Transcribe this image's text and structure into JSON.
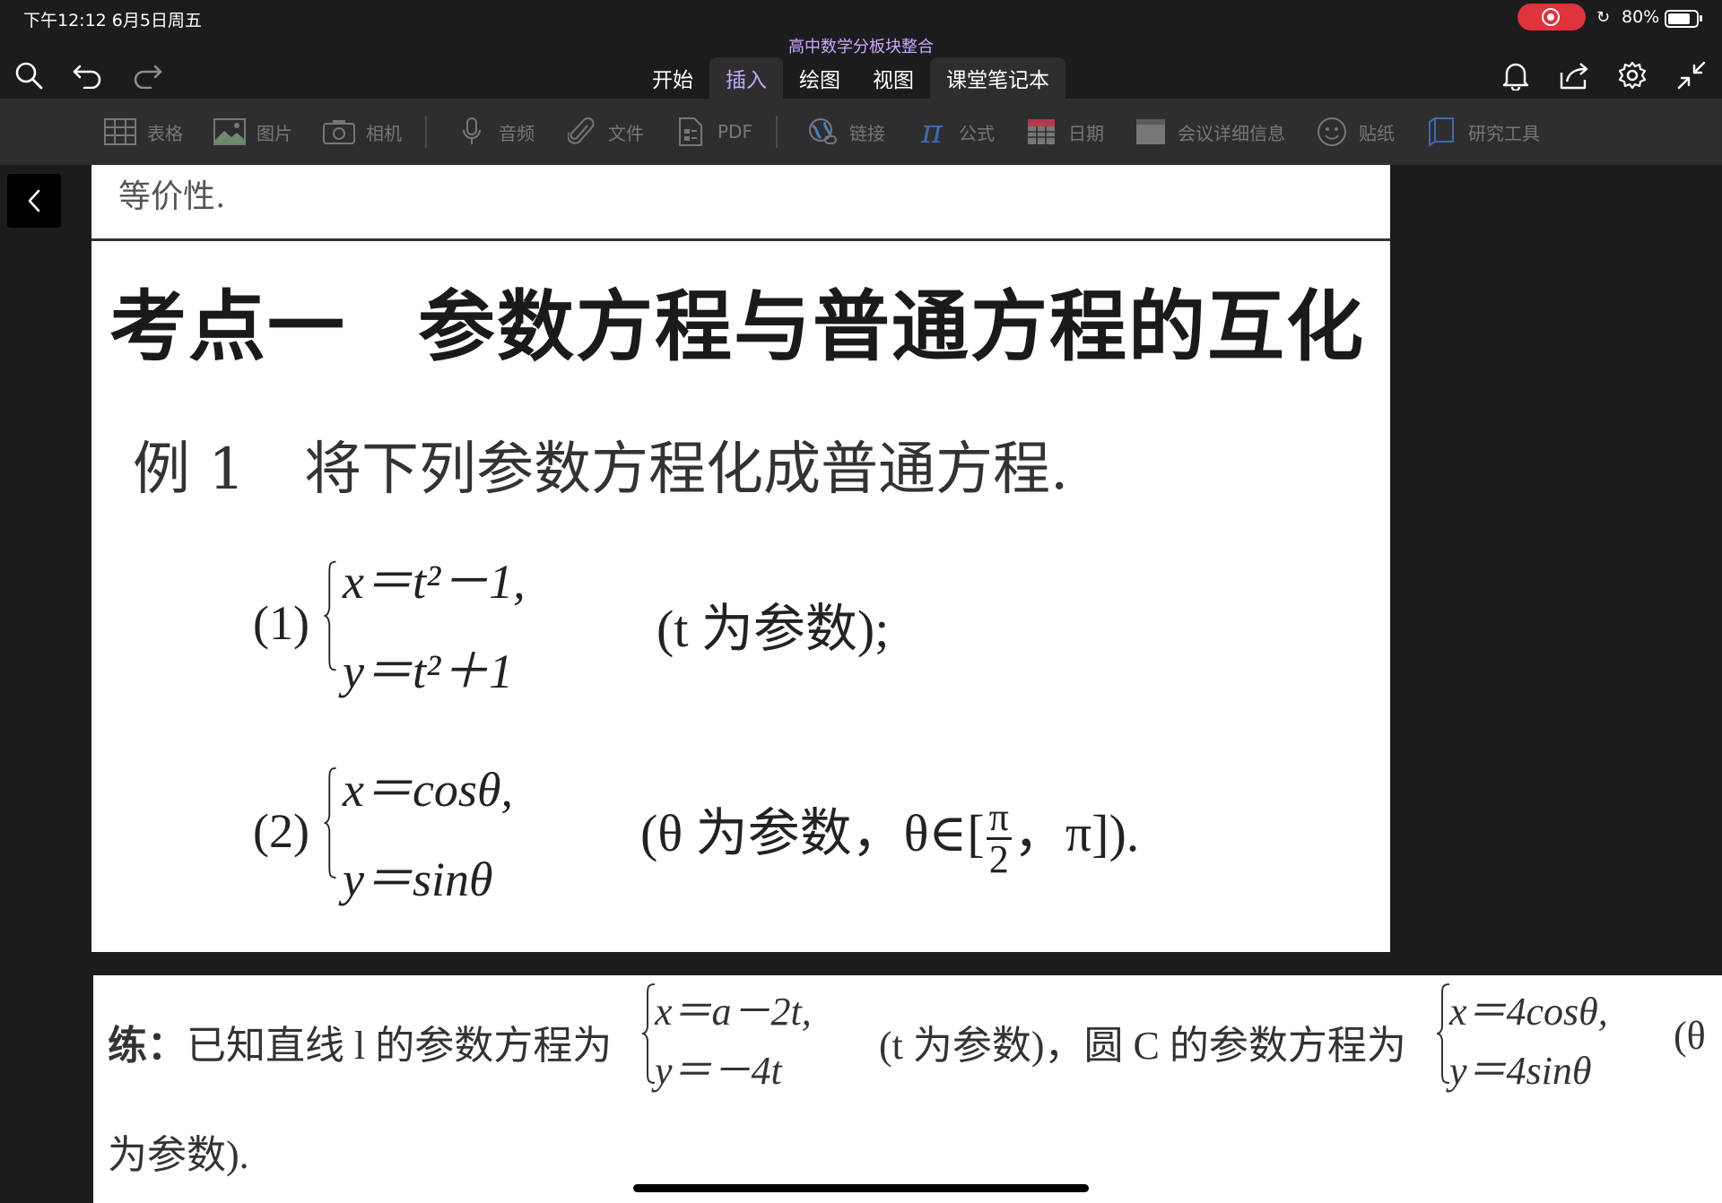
{
  "status_bar": {
    "time": "下午12:12   6月5日周五",
    "battery_percent": "80%",
    "battery_level": 0.8
  },
  "header": {
    "document_title": "高中数学分板块整合",
    "tabs": [
      "开始",
      "插入",
      "绘图",
      "视图",
      "课堂笔记本"
    ],
    "active_tab": "插入"
  },
  "ribbon": {
    "items": [
      "表格",
      "图片",
      "相机",
      "音频",
      "文件",
      "PDF",
      "链接",
      "公式",
      "日期",
      "会议详细信息",
      "贴纸",
      "研究工具"
    ]
  },
  "content": {
    "top_text": "等价性.",
    "heading_a": "考点一",
    "heading_b": "参数方程与普通方程的互化",
    "example_label": "例 1",
    "example_text": "将下列参数方程化成普通方程.",
    "p1": {
      "num": "(1)",
      "eq1": "x＝t²－1,",
      "eq2": "y＝t²＋1",
      "param": "(t 为参数);"
    },
    "p2": {
      "num": "(2)",
      "eq1": "x＝cosθ,",
      "eq2": "y＝sinθ",
      "param_a": "(θ 为参数，θ∈[",
      "frac_num": "π",
      "frac_den": "2",
      "param_b": "，π])."
    },
    "practice": {
      "label": "练：",
      "text_a": "已知直线 l 的参数方程为",
      "line_eq1": "x＝a－2t,",
      "line_eq2": "y＝－4t",
      "text_b": "(t 为参数)，圆 C 的参数方程为",
      "circle_eq1": "x＝4cosθ,",
      "circle_eq2": "y＝4sinθ",
      "text_c": "(θ",
      "text_d": "为参数)."
    }
  },
  "colors": {
    "accent": "#c9a8ff",
    "record": "#e0333b",
    "ribbon_bg": "#2e2e30",
    "app_bg": "#1c1c1e"
  }
}
